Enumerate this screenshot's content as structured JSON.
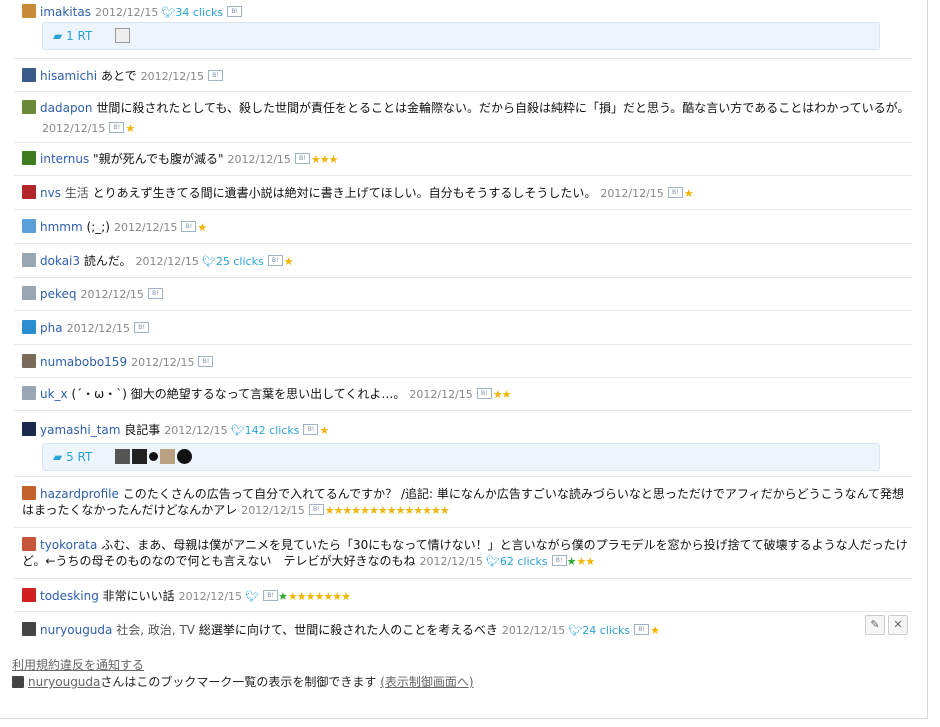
{
  "entries": [
    {
      "user": "imakitas",
      "tags": "",
      "comment": "",
      "date": "2012/12/15",
      "clicks": "34 clicks",
      "stars": "",
      "green_stars": "",
      "retweets": "1 RT",
      "avatar_color": "#c98a3a"
    },
    {
      "user": "hisamichi",
      "tags": "",
      "comment": "あとで",
      "date": "2012/12/15",
      "clicks": "",
      "stars": "",
      "green_stars": "",
      "avatar_color": "#3a5a8a"
    },
    {
      "user": "dadapon",
      "tags": "",
      "comment": "世間に殺されたとしても、殺した世間が責任をとることは金輪際ない。だから自殺は純粋に「損」だと思う。酷な言い方であることはわかっているが。",
      "date": "2012/12/15",
      "clicks": "",
      "stars": "★",
      "green_stars": "",
      "avatar_color": "#6a8a3a"
    },
    {
      "user": "internus",
      "tags": "",
      "comment": "\"親が死んでも腹が減る\"",
      "date": "2012/12/15",
      "clicks": "",
      "stars": "★★★",
      "green_stars": "",
      "avatar_color": "#3e7a1e"
    },
    {
      "user": "nvs",
      "tags": "生活",
      "comment": "とりあえず生きてる間に遺書小説は絶対に書き上げてほしい。自分もそうするしそうしたい。",
      "date": "2012/12/15",
      "clicks": "",
      "stars": "★",
      "green_stars": "",
      "avatar_color": "#b2262a"
    },
    {
      "user": "hmmm",
      "tags": "",
      "comment": "(;_;)",
      "date": "2012/12/15",
      "clicks": "",
      "stars": "★",
      "green_stars": "",
      "avatar_color": "#5aa0d8"
    },
    {
      "user": "dokai3",
      "tags": "",
      "comment": "読んだ。",
      "date": "2012/12/15",
      "clicks": "25 clicks",
      "stars": "★",
      "green_stars": "",
      "avatar_color": "#9aa6b4"
    },
    {
      "user": "pekeq",
      "tags": "",
      "comment": "",
      "date": "2012/12/15",
      "clicks": "",
      "stars": "",
      "green_stars": "",
      "avatar_color": "#9aa6b4"
    },
    {
      "user": "pha",
      "tags": "",
      "comment": "",
      "date": "2012/12/15",
      "clicks": "",
      "stars": "",
      "green_stars": "",
      "avatar_color": "#2a8fd0"
    },
    {
      "user": "numabobo159",
      "tags": "",
      "comment": "",
      "date": "2012/12/15",
      "clicks": "",
      "stars": "",
      "green_stars": "",
      "avatar_color": "#7a6a5a"
    },
    {
      "user": "uk_x",
      "tags": "",
      "comment": "(´・ω・`) 御大の絶望するなって言葉を思い出してくれよ…。",
      "date": "2012/12/15",
      "clicks": "",
      "stars": "★★",
      "green_stars": "",
      "avatar_color": "#9aa6b4"
    },
    {
      "user": "yamashi_tam",
      "tags": "",
      "comment": "良記事",
      "date": "2012/12/15",
      "clicks": "142 clicks",
      "stars": "★",
      "green_stars": "",
      "retweets": "5 RT",
      "avatar_color": "#1a2a4a"
    },
    {
      "user": "hazardprofile",
      "tags": "",
      "comment": "このたくさんの広告って自分で入れてるんですか？ /追記: 単になんか広告すごいな読みづらいなと思っただけでアフィだからどうこうなんて発想はまったくなかったんだけどなんかアレ",
      "date": "2012/12/15",
      "clicks": "",
      "stars": "★★★★★★★★★★★★★★",
      "green_stars": "",
      "avatar_color": "#c2622a"
    },
    {
      "user": "tyokorata",
      "tags": "",
      "comment": "ふむ、まあ、母親は僕がアニメを見ていたら「30にもなって情けない！」と言いながら僕のプラモデルを窓から投げ捨てて破壊するような人だったけど。←うちの母そのものなので何とも言えない　テレビが大好きなのもね",
      "date": "2012/12/15",
      "clicks": "62 clicks",
      "stars": "★★",
      "green_stars": "★",
      "avatar_color": "#c8563a"
    },
    {
      "user": "todesking",
      "tags": "",
      "comment": "非常にいい話",
      "date": "2012/12/15",
      "clicks": "",
      "stars": "★★★★★★★",
      "green_stars": "★",
      "avatar_color": "#d02020"
    },
    {
      "user": "nuryouguda",
      "tags": "社会, 政治, TV",
      "comment": "総選挙に向けて、世間に殺された人のことを考えるべき",
      "date": "2012/12/15",
      "clicks": "24 clicks",
      "stars": "★",
      "green_stars": "",
      "avatar_color": "#444444"
    }
  ],
  "footer": {
    "report_link": "利用規約違反を通知する",
    "owner": "nuryouguda",
    "control_text": "さんはこのブックマーク一覧の表示を制御できます",
    "control_link": "(表示制御画面へ)"
  },
  "icons": {
    "twitter": "twitter-bird-icon",
    "comment": "speech-bubble-icon",
    "edit": "pencil-icon",
    "delete": "close-icon",
    "count": "bookmark-count-icon"
  }
}
